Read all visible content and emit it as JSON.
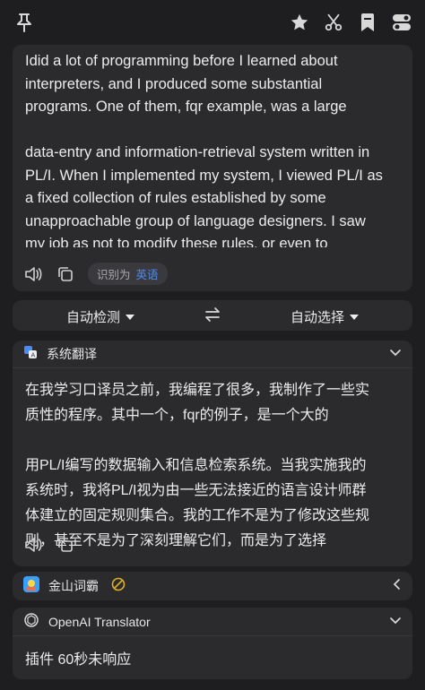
{
  "source": {
    "lines": [
      "Idid a lot of programming before I learned about",
      "interpreters, and I produced some substantial",
      "programs. One of them, fqr example, was a large",
      "",
      "data-entry and information-retrieval system written in",
      "PL/I. When I implemented my system, I viewed PL/I as",
      "a fixed collection of rules established by some",
      "unapproachable group of language designers. I saw",
      "my job as not to modify these rules, or even to"
    ],
    "detected_prefix": "识别为",
    "detected_lang": "英语"
  },
  "lang_bar": {
    "from": "自动检测",
    "to": "自动选择"
  },
  "system_translate": {
    "title": "系统翻译",
    "lines": [
      "在我学习口译员之前，我编程了很多，我制作了一些实",
      "质性的程序。其中一个，fqr的例子，是一个大的",
      "",
      "用PL/I编写的数据输入和信息检索系统。当我实施我的",
      "系统时，我将PL/I视为由一些无法接近的语言设计师群",
      "体建立的固定规则集合。我的工作不是为了修改这些规",
      "则，甚至不是为了深刻理解它们，而是为了选择"
    ]
  },
  "iciba": {
    "title": "金山词霸"
  },
  "openai": {
    "title": "OpenAI Translator",
    "message": "插件 60秒未响应"
  },
  "colors": {
    "background": "#1e1e20",
    "card": "#2b2b2e",
    "accent_blue": "#4a8cf7",
    "disabled_yellow": "#e0b020"
  }
}
